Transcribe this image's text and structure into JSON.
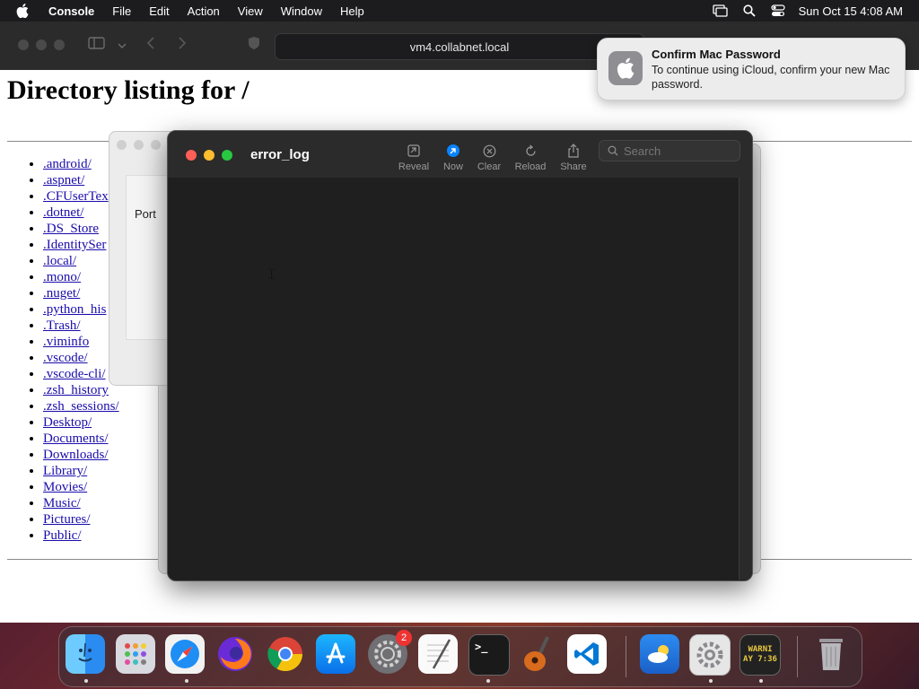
{
  "menubar": {
    "app_name": "Console",
    "items": [
      "File",
      "Edit",
      "Action",
      "View",
      "Window",
      "Help"
    ],
    "datetime": "Sun Oct 15  4:08 AM"
  },
  "safari": {
    "url": "vm4.collabnet.local"
  },
  "page": {
    "heading": "Directory listing for /",
    "links": [
      ".android/",
      ".aspnet/",
      ".CFUserTex",
      ".dotnet/",
      ".DS_Store",
      ".IdentitySer",
      ".local/",
      ".mono/",
      ".nuget/",
      ".python_his",
      ".Trash/",
      ".viminfo",
      ".vscode/",
      ".vscode-cli/",
      ".zsh_history",
      ".zsh_sessions/",
      "Desktop/",
      "Documents/",
      "Downloads/",
      "Library/",
      "Movies/",
      "Music/",
      "Pictures/",
      "Public/"
    ]
  },
  "background_window": {
    "label": "Port"
  },
  "console": {
    "title": "error_log",
    "toolbar": {
      "reveal": "Reveal",
      "now": "Now",
      "clear": "Clear",
      "reload": "Reload",
      "share": "Share"
    },
    "search_placeholder": "Search"
  },
  "notification": {
    "title": "Confirm Mac Password",
    "body": "To continue using iCloud, confirm your new Mac password."
  },
  "dock": {
    "apps": [
      "finder",
      "launchpad",
      "safari",
      "firefox",
      "chrome",
      "app-store",
      "system-settings",
      "textedit",
      "terminal",
      "garageband",
      "vscode",
      "weather",
      "settings",
      "console",
      "trash"
    ],
    "settings_badge": "2",
    "console_icon_text_1": "WARNI",
    "console_icon_text_2": "AY 7:36"
  },
  "colors": {
    "close": "#ff5f57",
    "minimize": "#febc2e",
    "maximize": "#28c840",
    "accent": "#0a84ff"
  }
}
